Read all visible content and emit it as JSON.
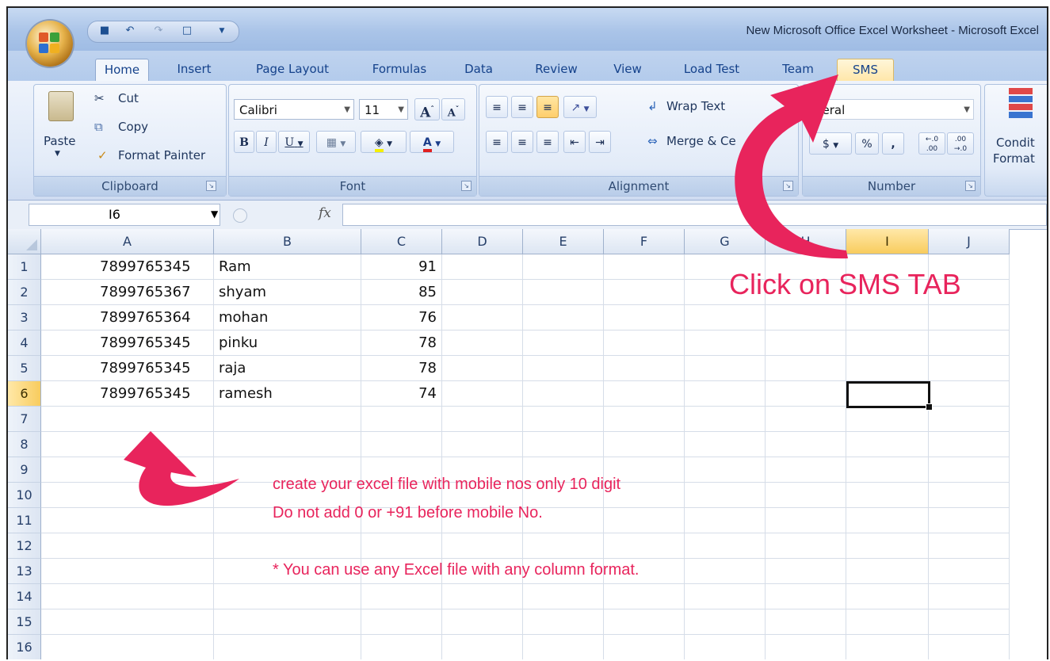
{
  "window": {
    "title": "New Microsoft Office Excel Worksheet - Microsoft Excel"
  },
  "ribbon": {
    "tabs": [
      {
        "label": "Home",
        "active": true
      },
      {
        "label": "Insert"
      },
      {
        "label": "Page Layout"
      },
      {
        "label": "Formulas"
      },
      {
        "label": "Data"
      },
      {
        "label": "Review"
      },
      {
        "label": "View"
      },
      {
        "label": "Load Test"
      },
      {
        "label": "Team"
      },
      {
        "label": "SMS",
        "highlighted": true
      }
    ],
    "clipboard": {
      "group_label": "Clipboard",
      "paste": "Paste",
      "cut": "Cut",
      "copy": "Copy",
      "format_painter": "Format Painter"
    },
    "font": {
      "group_label": "Font",
      "font_name": "Calibri",
      "font_size": "11",
      "bold": "B",
      "italic": "I",
      "underline": "U",
      "grow": "A",
      "shrink": "A"
    },
    "alignment": {
      "group_label": "Alignment",
      "wrap_text": "Wrap Text",
      "merge_center": "Merge & Ce"
    },
    "number": {
      "group_label": "Number",
      "format": "neral",
      "percent": "%",
      "comma": ",",
      "inc_decimal": "←.0 .00",
      "dec_decimal": ".00 →.0"
    },
    "styles": {
      "conditional": "Condit",
      "format": "Format"
    }
  },
  "formula_bar": {
    "name_box": "I6",
    "fx": "fx",
    "value": ""
  },
  "sheet": {
    "columns": [
      "A",
      "B",
      "C",
      "D",
      "E",
      "F",
      "G",
      "H",
      "I",
      "J"
    ],
    "selected_column": "I",
    "rows": [
      "1",
      "2",
      "3",
      "4",
      "5",
      "6",
      "7",
      "8",
      "9",
      "10",
      "11",
      "12",
      "13",
      "14",
      "15",
      "16"
    ],
    "selected_row": "6",
    "data": [
      {
        "a": "7899765345",
        "b": "Ram",
        "c": "91"
      },
      {
        "a": "7899765367",
        "b": "shyam",
        "c": "85"
      },
      {
        "a": "7899765364",
        "b": "mohan",
        "c": "76"
      },
      {
        "a": "7899765345",
        "b": "pinku",
        "c": "78"
      },
      {
        "a": "7899765345",
        "b": "raja",
        "c": "78"
      },
      {
        "a": "7899765345",
        "b": "ramesh",
        "c": "74"
      }
    ]
  },
  "annotations": {
    "click_sms": "Click on SMS TAB",
    "line1": "create your excel file with mobile nos only 10 digit",
    "line2": "Do not add 0 or +91 before mobile No.",
    "line3": "* You can use any Excel file with any column format.",
    "color": "#e8245c"
  }
}
